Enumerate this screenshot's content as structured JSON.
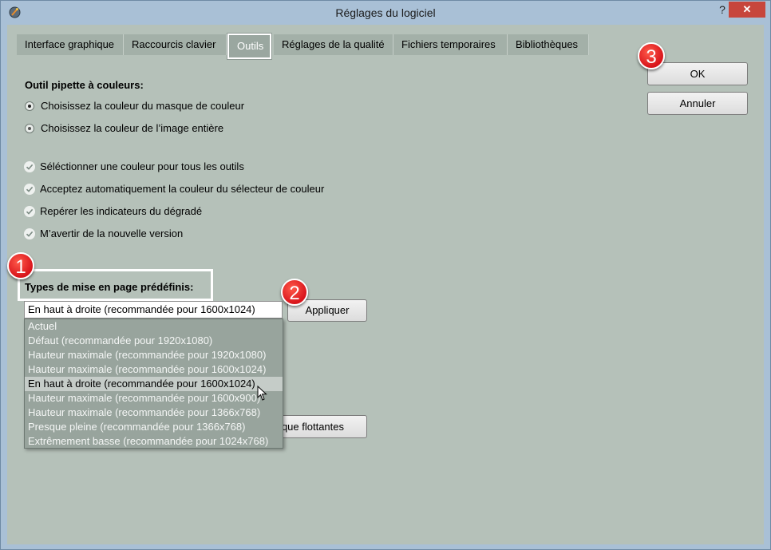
{
  "window": {
    "title": "Réglages du logiciel",
    "help_label": "?",
    "close_label": "✕"
  },
  "tabs": [
    {
      "label": "Interface graphique",
      "active": false
    },
    {
      "label": "Raccourcis clavier",
      "active": false
    },
    {
      "label": "Outils",
      "active": true
    },
    {
      "label": "Réglages de la qualité",
      "active": false
    },
    {
      "label": "Fichiers temporaires",
      "active": false
    },
    {
      "label": "Bibliothèques",
      "active": false
    }
  ],
  "eyedropper": {
    "title": "Outil pipette à couleurs:",
    "options": [
      {
        "label": "Choisissez la couleur du masque de couleur",
        "selected": true
      },
      {
        "label": "Choisissez la couleur de l’image entière",
        "selected": false
      }
    ]
  },
  "checkboxes": [
    {
      "label": "Séléctionner une couleur pour tous les outils",
      "checked": true
    },
    {
      "label": "Acceptez automatiquement la couleur du sélecteur de couleur",
      "checked": true
    },
    {
      "label": "Repérer les indicateurs du dégradé",
      "checked": true
    },
    {
      "label": "M’avertir de la nouvelle version",
      "checked": true
    }
  ],
  "layout_presets": {
    "title": "Types de mise en page prédéfinis:",
    "current_value": "En haut à droite (recommandée pour 1600x1024)",
    "apply_label": "Appliquer",
    "options": [
      "Actuel",
      "Défaut (recommandée pour 1920x1080)",
      "Hauteur maximale (recommandée pour 1920x1080)",
      "Hauteur maximale (recommandée pour 1600x1024)",
      "En haut à droite (recommandée pour 1600x1024)",
      "Hauteur maximale (recommandée pour 1600x900)",
      "Hauteur maximale (recommandée pour 1366x768)",
      "Presque pleine (recommandée pour 1366x768)",
      "Extrêmement basse (recommandée pour 1024x768)"
    ],
    "selected_index": 4
  },
  "hidden_button_partial_label": "que flottantes",
  "buttons": {
    "ok": "OK",
    "cancel": "Annuler"
  },
  "badges": [
    "1",
    "2",
    "3"
  ],
  "colors": {
    "window_frame": "#a9c0d6",
    "client_bg": "#b5c1b9",
    "close_red": "#c7463c",
    "badge_red": "#d8141b"
  }
}
